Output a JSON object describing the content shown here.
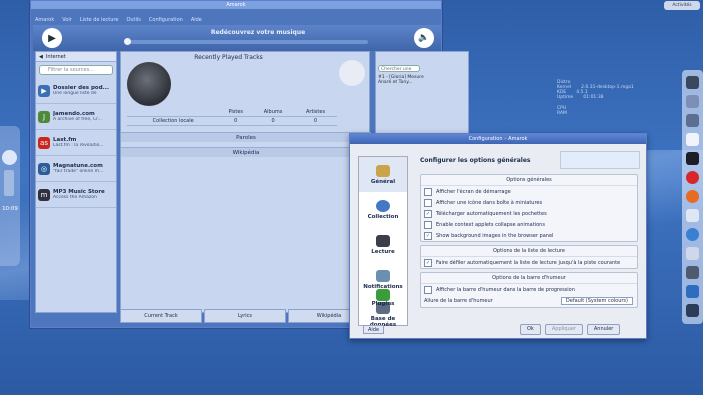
{
  "amarok": {
    "title": "Amarok",
    "menu": [
      "Amarok",
      "Voir",
      "Liste de lecture",
      "Outils",
      "Configuration",
      "Aide"
    ],
    "now_playing": "Redécouvrez votre musique",
    "sources_tab": "Internet",
    "filter_placeholder": "Filtrer la sources...",
    "services": [
      {
        "title": "Dossier des pod...",
        "desc": "Une longue liste de",
        "color": "#3b6fb6",
        "glyph": "▶"
      },
      {
        "title": "Jamendo.com",
        "desc": "A archive of free, Cr...",
        "color": "#4f8a3a",
        "glyph": "J"
      },
      {
        "title": "Last.fm",
        "desc": "Last.fm : la révolutio...",
        "color": "#c8281e",
        "glyph": "as"
      },
      {
        "title": "Magnatune.com",
        "desc": "\"fair trade\" online m...",
        "color": "#2c5c9a",
        "glyph": "◎"
      },
      {
        "title": "MP3 Music Store",
        "desc": "Access the Amazon",
        "color": "#303040",
        "glyph": "m"
      }
    ],
    "recent_title": "Recently Played Tracks",
    "stats_headers": [
      "",
      "Pistes",
      "Albums",
      "Artistes"
    ],
    "stats_row": [
      "Collection locale",
      "0",
      "0",
      "0"
    ],
    "drawers": [
      "Paroles",
      "Wikipédia"
    ],
    "bottom_tabs": [
      "Current Track",
      "Lyrics",
      "Wikipédia"
    ],
    "playlist_search": "Chercher une",
    "playlist_items": [
      "#1 - [Gloria] Mesure",
      "Anaré et Tony..."
    ]
  },
  "config": {
    "title": "Configuration – Amarok",
    "heading": "Configurer les options générales",
    "nav": [
      {
        "label": "Général",
        "color": "#c9a44a"
      },
      {
        "label": "Collection",
        "color": "#4478c4"
      },
      {
        "label": "Lecture",
        "color": "#3b3f49"
      },
      {
        "label": "Notifications",
        "color": "#6b8fb0"
      },
      {
        "label": "Base de données",
        "color": "#5a6d85"
      },
      {
        "label": "Plugins",
        "color": "#3a9c3a"
      }
    ],
    "group1": {
      "title": "Options générales",
      "options": [
        {
          "label": "Afficher l'écran de démarrage",
          "checked": false
        },
        {
          "label": "Afficher une icône dans boîte à miniatures",
          "checked": false
        },
        {
          "label": "Télécharger automatiquement les pochettes",
          "checked": true
        },
        {
          "label": "Enable context applets collapse animations",
          "checked": false
        },
        {
          "label": "Show background images in the browser panel",
          "checked": true
        }
      ]
    },
    "group2": {
      "title": "Options de la liste de lecture",
      "options": [
        {
          "label": "Faire défiler automatiquement la liste de lecture jusqu'à la piste courante",
          "checked": true
        }
      ]
    },
    "group3": {
      "title": "Options de la barre d'humeur",
      "options": [
        {
          "label": "Afficher la barre d'humeur dans la barre de progression",
          "checked": false
        }
      ],
      "style_label": "Allure de la barre d'humeur",
      "style_value": "Default (System colours)"
    },
    "buttons": {
      "ok": "Ok",
      "apply": "Appliquer",
      "cancel": "Annuler",
      "help": "Aide"
    }
  },
  "desktop": {
    "clock": "10:09",
    "top_button": "Activités",
    "sysinfo": [
      {
        "k": "Distro",
        "v": ""
      },
      {
        "k": "Kernel",
        "v": "2.6.31-desktop-1.mga1"
      },
      {
        "k": "KDE",
        "v": "4.5.1"
      },
      {
        "k": "Uptime",
        "v": "01:01:38"
      },
      {
        "k": "CPU",
        "v": ""
      },
      {
        "k": "RAM",
        "v": ""
      }
    ]
  }
}
